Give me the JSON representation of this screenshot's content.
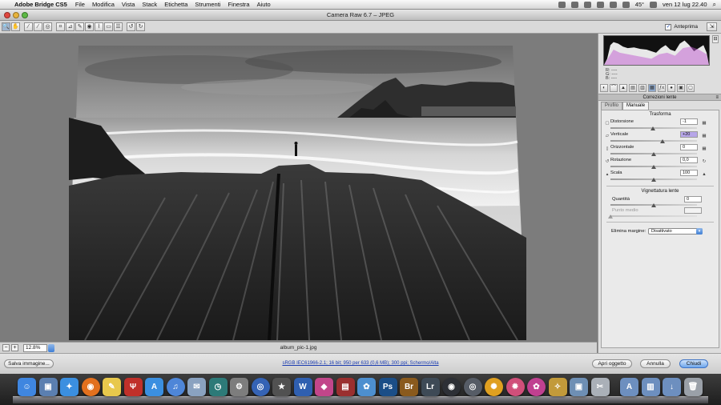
{
  "menubar": {
    "apple_glyph": "",
    "app_name": "Adobe Bridge CS5",
    "items": [
      "File",
      "Modifica",
      "Vista",
      "Stack",
      "Etichetta",
      "Strumenti",
      "Finestra",
      "Aiuto"
    ],
    "temperature": "45°",
    "datetime": "ven 12 lug  22.40"
  },
  "window": {
    "title": "Camera Raw 6.7  –  JPEG",
    "preview_label": "Anteprima",
    "preview_checked": true
  },
  "toolbar": {
    "tools": [
      {
        "name": "zoom-tool",
        "icon": "zoom-icon",
        "glyph": "🔍",
        "selected": true
      },
      {
        "name": "hand-tool",
        "icon": "hand-icon",
        "glyph": "✋"
      },
      {
        "name": "white-balance-tool",
        "icon": "eyedropper-icon",
        "glyph": "⁄"
      },
      {
        "name": "color-sampler-tool",
        "icon": "color-sampler-icon",
        "glyph": "⁄"
      },
      {
        "name": "targeted-adjustment-tool",
        "icon": "target-icon",
        "glyph": "◎"
      },
      {
        "name": "crop-tool",
        "icon": "crop-icon",
        "glyph": "⌗"
      },
      {
        "name": "straighten-tool",
        "icon": "straighten-icon",
        "glyph": "⊿"
      },
      {
        "name": "spot-removal-tool",
        "icon": "spot-removal-icon",
        "glyph": "✎"
      },
      {
        "name": "red-eye-tool",
        "icon": "red-eye-icon",
        "glyph": "◉"
      },
      {
        "name": "adjustment-brush-tool",
        "icon": "brush-icon",
        "glyph": "⌇"
      },
      {
        "name": "graduated-filter-tool",
        "icon": "gradient-filter-icon",
        "glyph": "▭"
      },
      {
        "name": "preferences-tool",
        "icon": "list-icon",
        "glyph": "☰"
      },
      {
        "name": "rotate-left-tool",
        "icon": "rotate-left-icon",
        "glyph": "↺"
      },
      {
        "name": "rotate-right-tool",
        "icon": "rotate-right-icon",
        "glyph": "↻"
      }
    ]
  },
  "status": {
    "zoom_value": "12.8%",
    "filename": "album_pic-1.jpg"
  },
  "panel": {
    "rgb_labels": {
      "r": "R:   ----",
      "g": "G:   ----",
      "b": "B:   ----"
    },
    "section_title": "Correzioni lente",
    "tabs": [
      {
        "name": "basic",
        "glyph": "◐"
      },
      {
        "name": "tone-curve",
        "glyph": "⌒"
      },
      {
        "name": "detail",
        "glyph": "▲"
      },
      {
        "name": "hsl",
        "glyph": "▤"
      },
      {
        "name": "split-toning",
        "glyph": "▥"
      },
      {
        "name": "lens-corrections",
        "glyph": "▦"
      },
      {
        "name": "effects",
        "glyph": "ƒx"
      },
      {
        "name": "camera-calibration",
        "glyph": "●"
      },
      {
        "name": "presets",
        "glyph": "▣"
      },
      {
        "name": "snapshots",
        "glyph": "▢"
      }
    ],
    "subtabs": [
      "Profilo",
      "Manuale"
    ],
    "trasforma": {
      "heading": "Trasforma",
      "sliders": [
        {
          "label": "Distorsione",
          "value": "-1",
          "fraction": 0.495,
          "highlight": false
        },
        {
          "label": "Verticale",
          "value": "+20",
          "fraction": 0.6,
          "highlight": true
        },
        {
          "label": "Orizzontale",
          "value": "0",
          "fraction": 0.5,
          "highlight": false
        },
        {
          "label": "Rotazione",
          "value": "0,0",
          "fraction": 0.5,
          "highlight": false
        },
        {
          "label": "Scala",
          "value": "100",
          "fraction": 0.5,
          "highlight": false
        }
      ]
    },
    "vignettatura": {
      "heading": "Vignettatura lente",
      "quantita_label": "Quantità",
      "quantita_value": "0",
      "quantita_fraction": 0.5,
      "punto_medio_label": "Punto medio",
      "punto_medio_value": "",
      "punto_medio_fraction": 0.0
    },
    "elimina": {
      "label": "Elimina margine:",
      "value": "Disattivato"
    }
  },
  "footer": {
    "save_label": "Salva immagine...",
    "workflow_text": "sRGB IEC61966-2.1; 16 bit; 950 per 633 (0,6 MB); 300 ppi; Schermo/Alta",
    "open_label": "Apri oggetto",
    "cancel_label": "Annulla",
    "close_label": "Chiudi"
  },
  "dock": {
    "apps": [
      {
        "name": "finder",
        "glyph": "☺",
        "color": "#3f86e0"
      },
      {
        "name": "preview",
        "glyph": "▣",
        "color": "#5b7fb0"
      },
      {
        "name": "safari",
        "glyph": "✦",
        "color": "#3b8fe0"
      },
      {
        "name": "firefox",
        "glyph": "◉",
        "color": "#e2701e"
      },
      {
        "name": "notes",
        "glyph": "✎",
        "color": "#e8c84c"
      },
      {
        "name": "filezilla",
        "glyph": "Ψ",
        "color": "#c0302a"
      },
      {
        "name": "app-store",
        "glyph": "A",
        "color": "#3b8fe0"
      },
      {
        "name": "itunes",
        "glyph": "♫",
        "color": "#4e86d8"
      },
      {
        "name": "mail",
        "glyph": "✉",
        "color": "#8aa2c0"
      },
      {
        "name": "time-machine",
        "glyph": "◷",
        "color": "#2d7a78"
      },
      {
        "name": "system-preferences",
        "glyph": "⚙",
        "color": "#7d7d7d"
      },
      {
        "name": "dvd-player",
        "glyph": "◎",
        "color": "#3563b5"
      },
      {
        "name": "imovie",
        "glyph": "★",
        "color": "#515151"
      },
      {
        "name": "word",
        "glyph": "W",
        "color": "#2f5fb0"
      },
      {
        "name": "color-app",
        "glyph": "◆",
        "color": "#c2468a"
      },
      {
        "name": "photo-booth",
        "glyph": "▤",
        "color": "#9a2f2f"
      },
      {
        "name": "iphoto",
        "glyph": "✿",
        "color": "#4d8fcf"
      },
      {
        "name": "photoshop",
        "glyph": "Ps",
        "color": "#1b4e87"
      },
      {
        "name": "bridge",
        "glyph": "Br",
        "color": "#8a5a1d"
      },
      {
        "name": "lightroom",
        "glyph": "Lr",
        "color": "#3e4a56"
      },
      {
        "name": "aperture",
        "glyph": "◉",
        "color": "#2d3036"
      },
      {
        "name": "camera",
        "glyph": "◎",
        "color": "#565c66"
      },
      {
        "name": "pinwheel",
        "glyph": "✺",
        "color": "#e0a020"
      },
      {
        "name": "color-wheel",
        "glyph": "✹",
        "color": "#d04f7a"
      },
      {
        "name": "flower",
        "glyph": "✿",
        "color": "#c04090"
      },
      {
        "name": "sketch",
        "glyph": "✧",
        "color": "#c29a3a"
      },
      {
        "name": "preview-doc",
        "glyph": "▣",
        "color": "#6e8fb4"
      },
      {
        "name": "grab",
        "glyph": "✂",
        "color": "#aab0b8"
      }
    ],
    "stacks": [
      {
        "name": "applications-stack",
        "glyph": "A",
        "color": "#6d8fbf"
      },
      {
        "name": "documents-stack",
        "glyph": "▥",
        "color": "#6d8fbf"
      },
      {
        "name": "downloads-stack",
        "glyph": "↓",
        "color": "#6d8fbf"
      },
      {
        "name": "trash",
        "glyph": "🗑",
        "color": "#9aa0a8"
      }
    ]
  }
}
